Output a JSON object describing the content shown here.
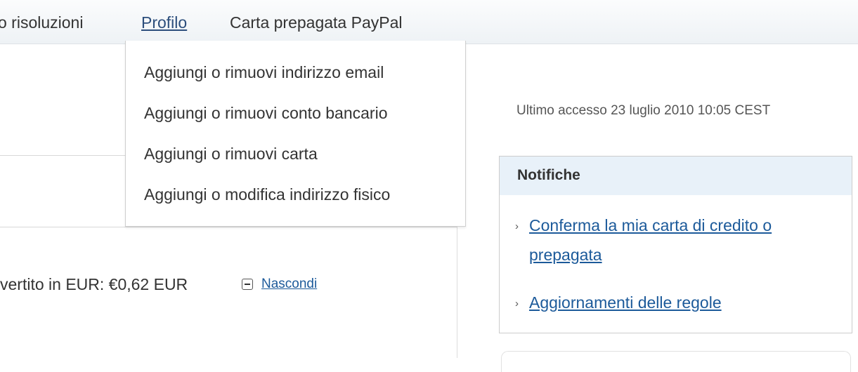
{
  "nav": {
    "items": [
      {
        "label": "o risoluzioni"
      },
      {
        "label": "Profilo"
      },
      {
        "label": "Carta prepagata PayPal"
      }
    ]
  },
  "profile_menu": {
    "items": [
      {
        "label": "Aggiungi o rimuovi indirizzo email"
      },
      {
        "label": "Aggiungi o rimuovi conto bancario"
      },
      {
        "label": "Aggiungi o rimuovi carta"
      },
      {
        "label": "Aggiungi o modifica indirizzo fisico"
      }
    ]
  },
  "last_access": "Ultimo accesso 23 luglio 2010 10:05 CEST",
  "notifications": {
    "title": "Notifiche",
    "links": [
      {
        "line1": "Conferma la mia carta di credito o",
        "line2": "prepagata"
      },
      {
        "line1": "Aggiornamenti delle regole"
      }
    ]
  },
  "balance": {
    "converted_text": "vertito in EUR: €0,62 EUR",
    "hide_label": "Nascondi"
  }
}
